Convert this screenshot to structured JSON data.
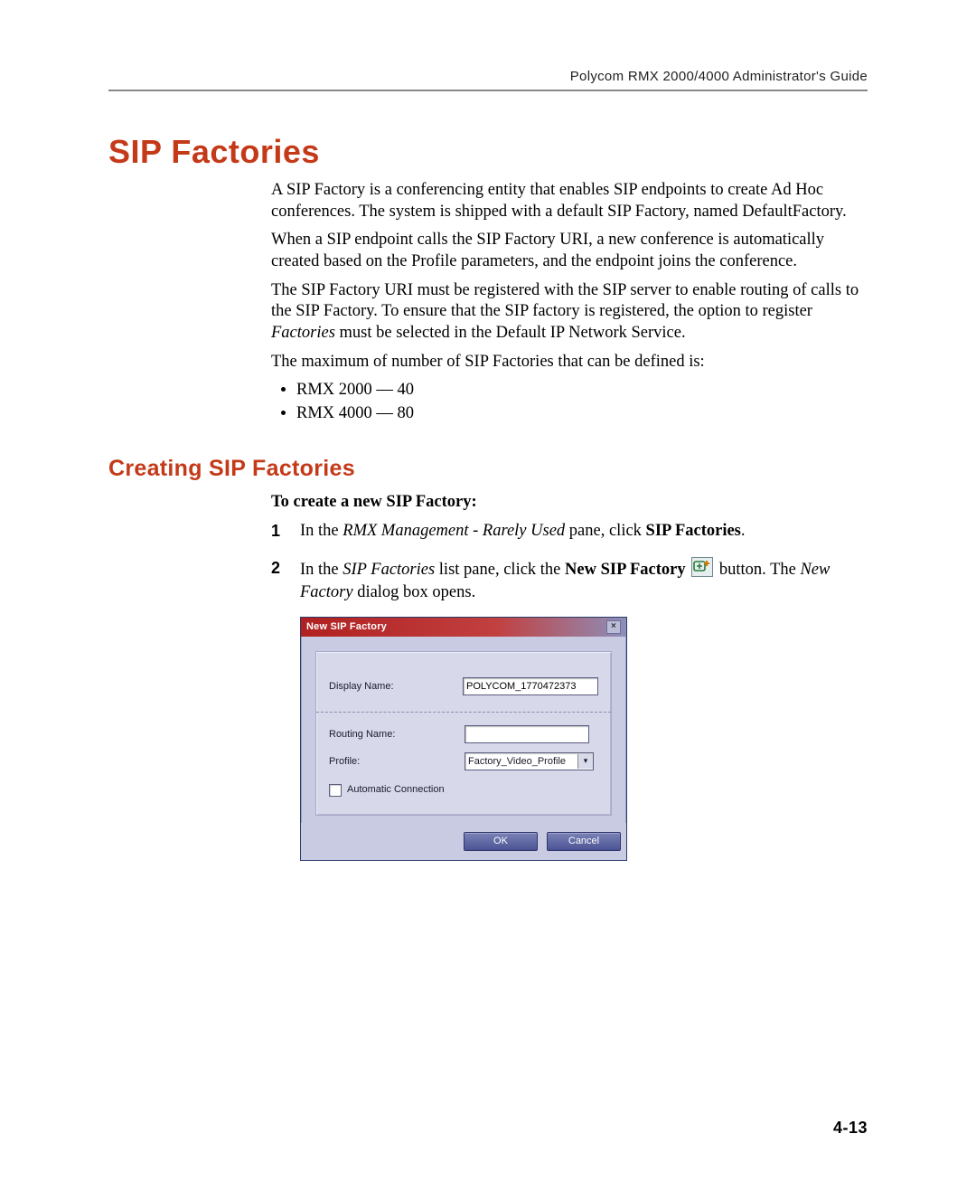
{
  "header": {
    "running_title": "Polycom RMX 2000/4000 Administrator's Guide"
  },
  "section": {
    "title": "SIP Factories",
    "p1": "A SIP Factory is a conferencing entity that enables SIP endpoints to create Ad Hoc conferences. The system is shipped with a default SIP Factory, named DefaultFactory.",
    "p2": "When a SIP endpoint calls the SIP Factory URI, a new conference is automatically created based on the Profile parameters, and the endpoint joins the conference.",
    "p3_a": "The SIP Factory URI must be registered with the SIP server to enable routing of calls to the SIP Factory. To ensure that the SIP factory is registered, the option to register ",
    "p3_italic": "Factories",
    "p3_b": " must be selected in the Default IP Network Service.",
    "p4": "The maximum of number of SIP Factories that can be defined is:",
    "bullets": [
      "RMX 2000 — 40",
      "RMX 4000 — 80"
    ]
  },
  "subsection": {
    "title": "Creating SIP Factories",
    "steps_heading": "To create a new SIP Factory:",
    "step1": {
      "num": "1",
      "a": "In the ",
      "italic": "RMX Management - Rarely Used",
      "b": " pane, click ",
      "bold": "SIP Factories",
      "c": "."
    },
    "step2": {
      "num": "2",
      "a": "In the ",
      "italic1": "SIP Factories",
      "b": " list pane, click the ",
      "bold": "New SIP Factory",
      "c": " button. The ",
      "italic2": "New Factory",
      "d": " dialog box opens."
    }
  },
  "dialog": {
    "title": "New SIP Factory",
    "close_glyph": "×",
    "display_name_label": "Display Name:",
    "display_name_value": "POLYCOM_1770472373",
    "routing_name_label": "Routing Name:",
    "routing_name_value": "",
    "profile_label": "Profile:",
    "profile_value": "Factory_Video_Profile",
    "auto_conn_label": "Automatic Connection",
    "ok": "OK",
    "cancel": "Cancel"
  },
  "page_number": "4-13"
}
